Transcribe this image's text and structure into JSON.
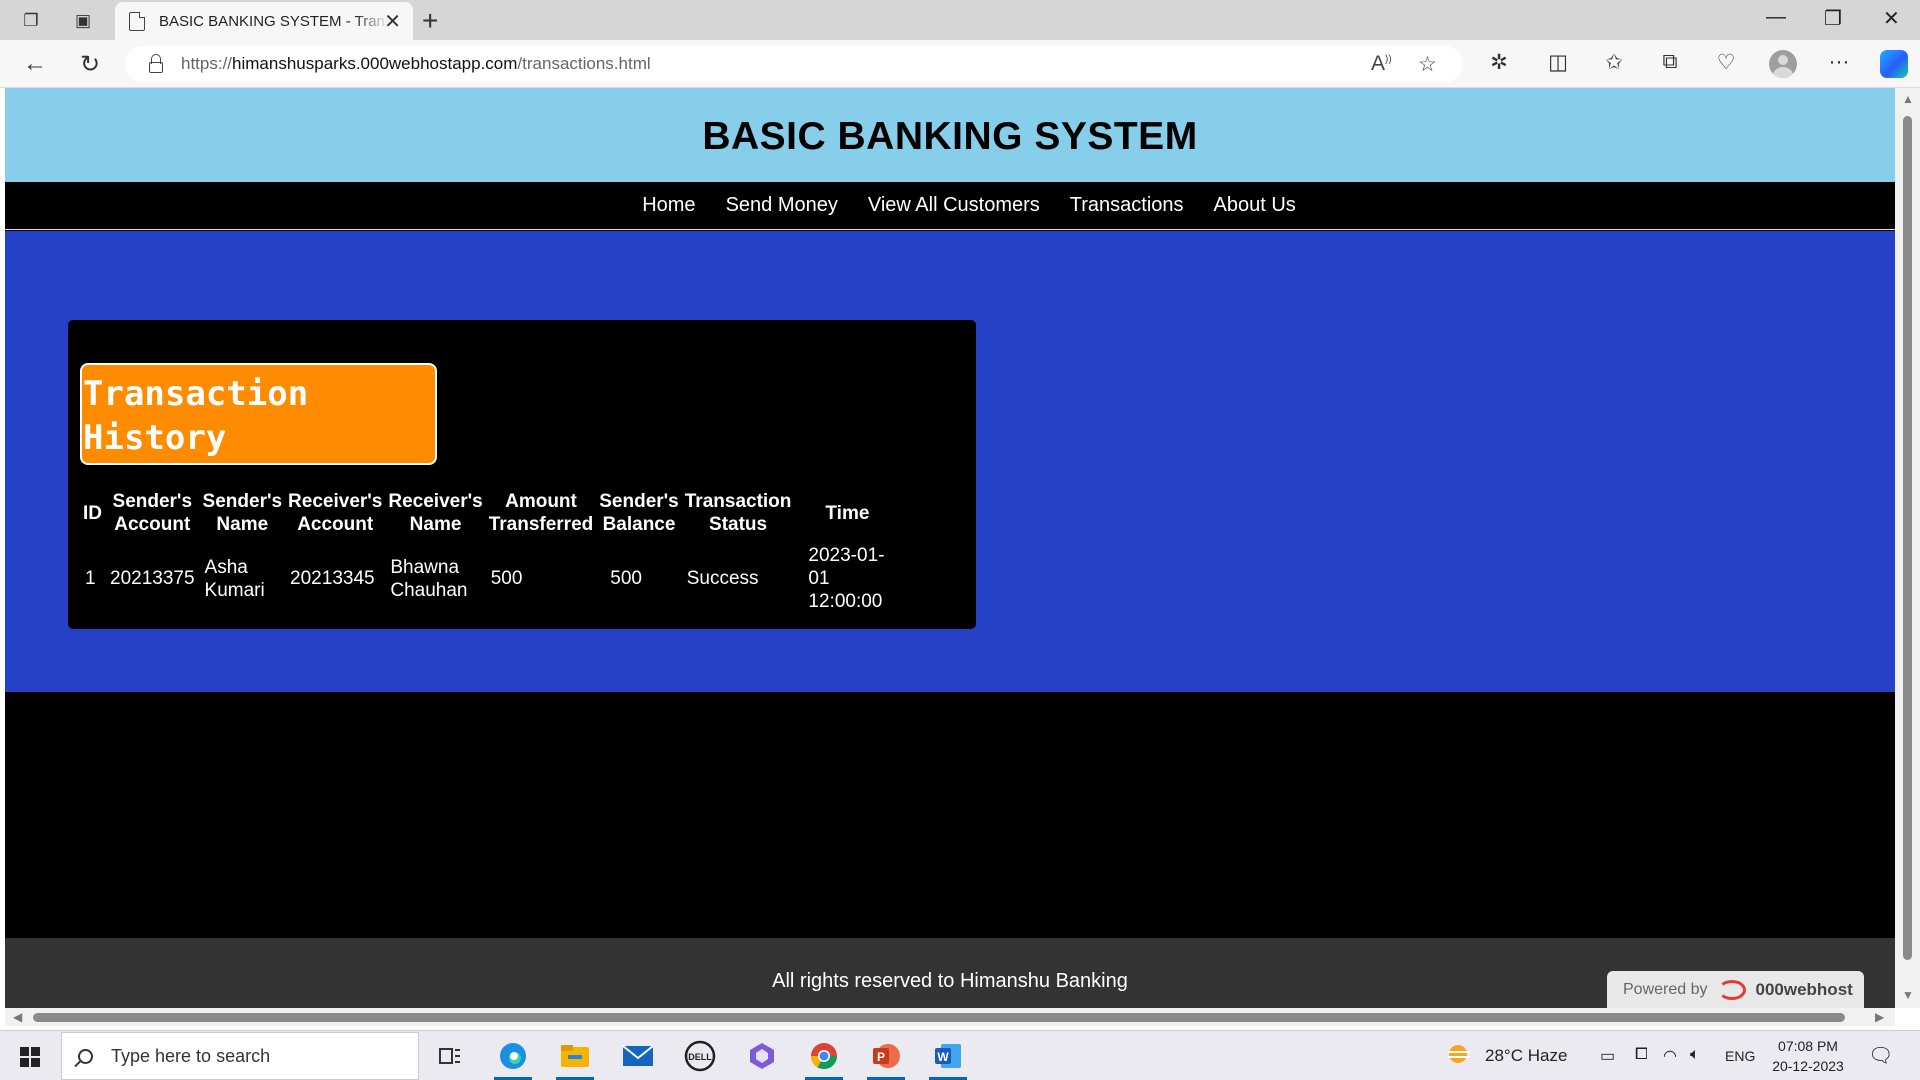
{
  "browser": {
    "tab_title": "BASIC BANKING SYSTEM - Transactions",
    "url_prefix": "https://",
    "url_host": "himanshusparks.000webhostapp.com",
    "url_path": "/transactions.html"
  },
  "site": {
    "title": "BASIC BANKING SYSTEM",
    "nav": [
      "Home",
      "Send Money",
      "View All Customers",
      "Transactions",
      "About Us"
    ],
    "section_title_line1": "Transaction",
    "section_title_line2": "History",
    "table": {
      "headers": [
        [
          "ID"
        ],
        [
          "Sender's",
          "Account"
        ],
        [
          "Sender's",
          "Name"
        ],
        [
          "Receiver's",
          "Account"
        ],
        [
          "Receiver's",
          "Name"
        ],
        [
          "Amount",
          "Transferred"
        ],
        [
          "Sender's",
          "Balance"
        ],
        [
          "Transaction",
          "Status"
        ],
        [
          "Time"
        ]
      ],
      "rows": [
        {
          "id": "1",
          "sender_account": "20213375",
          "sender_name_1": "Asha",
          "sender_name_2": "Kumari",
          "receiver_account": "20213345",
          "receiver_name_1": "Bhawna",
          "receiver_name_2": "Chauhan",
          "amount": "500",
          "balance": "500",
          "status": "Success",
          "time_1": "2023-01-",
          "time_2": "01",
          "time_3": "12:00:00"
        }
      ]
    },
    "footer": "All rights reserved to Himanshu Banking",
    "powered_by": "Powered by",
    "powered_brand": "000webhost"
  },
  "taskbar": {
    "search_placeholder": "Type here to search",
    "weather": "28°C  Haze",
    "language": "ENG",
    "time": "07:08 PM",
    "date": "20-12-2023"
  },
  "colors": {
    "header_bg": "#87ceeb",
    "content_bg": "#2541c7",
    "badge_bg": "#ff8c00",
    "footer_bg": "#333333"
  }
}
